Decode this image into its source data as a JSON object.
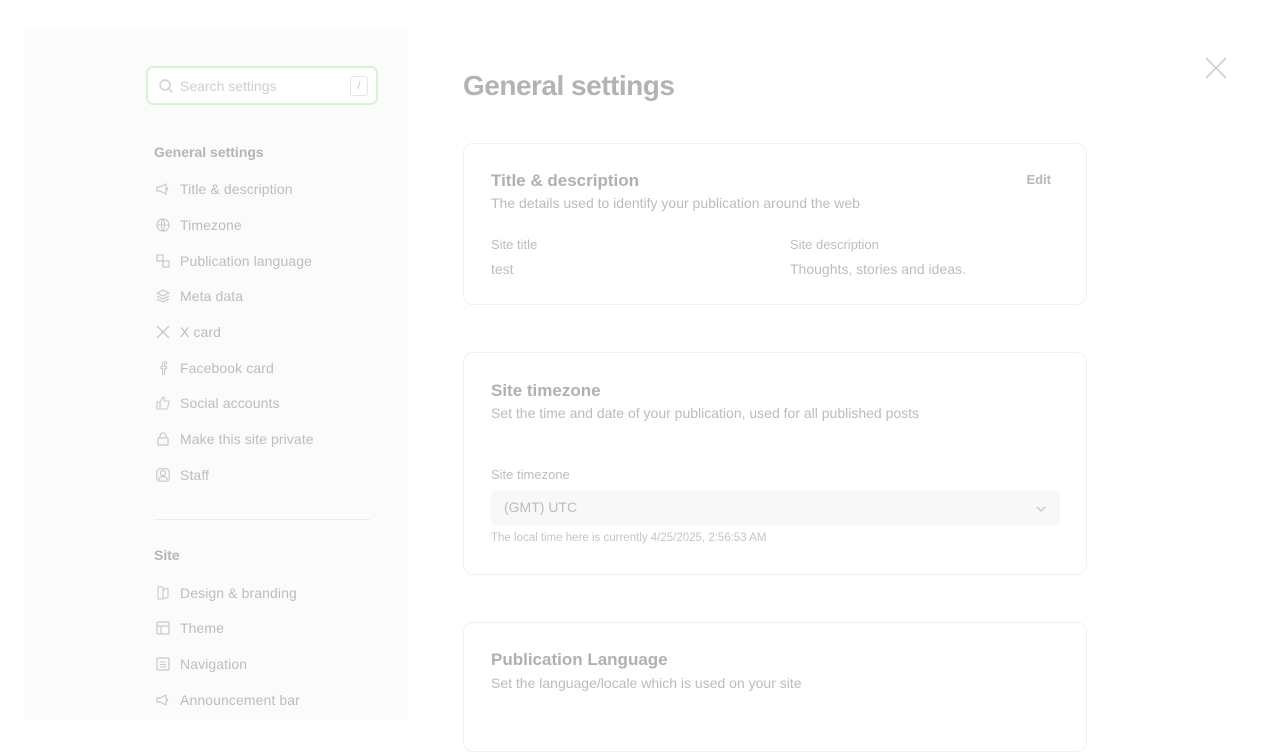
{
  "search": {
    "placeholder": "Search settings",
    "shortcut": "/"
  },
  "sidebar": {
    "general_title": "General settings",
    "general_items": [
      {
        "label": "Title & description",
        "icon": "megaphone-icon"
      },
      {
        "label": "Timezone",
        "icon": "globe-icon"
      },
      {
        "label": "Publication language",
        "icon": "language-icon"
      },
      {
        "label": "Meta data",
        "icon": "layers-icon"
      },
      {
        "label": "X card",
        "icon": "x-logo-icon"
      },
      {
        "label": "Facebook card",
        "icon": "facebook-icon"
      },
      {
        "label": "Social accounts",
        "icon": "thumbs-up-icon"
      },
      {
        "label": "Make this site private",
        "icon": "lock-icon"
      },
      {
        "label": "Staff",
        "icon": "staff-icon"
      }
    ],
    "site_title": "Site",
    "site_items": [
      {
        "label": "Design & branding",
        "icon": "paint-brush-icon"
      },
      {
        "label": "Theme",
        "icon": "layout-icon"
      },
      {
        "label": "Navigation",
        "icon": "menu-list-icon"
      },
      {
        "label": "Announcement bar",
        "icon": "announcement-icon"
      }
    ]
  },
  "main": {
    "title": "General settings",
    "title_card": {
      "title": "Title & description",
      "description": "The details used to identify your publication around the web",
      "edit_label": "Edit",
      "site_title_label": "Site title",
      "site_title_value": "test",
      "site_description_label": "Site description",
      "site_description_value": "Thoughts, stories and ideas."
    },
    "timezone_card": {
      "title": "Site timezone",
      "description": "Set the time and date of your publication, used for all published posts",
      "field_label": "Site timezone",
      "selected": "(GMT) UTC",
      "hint": "The local time here is currently 4/25/2025, 2:56:53 AM"
    },
    "language_card": {
      "title": "Publication Language",
      "description": "Set the language/locale which is used on your site"
    }
  },
  "colors": {
    "accent_border": "#d8f2d6",
    "muted_text": "#bdbdbd"
  }
}
